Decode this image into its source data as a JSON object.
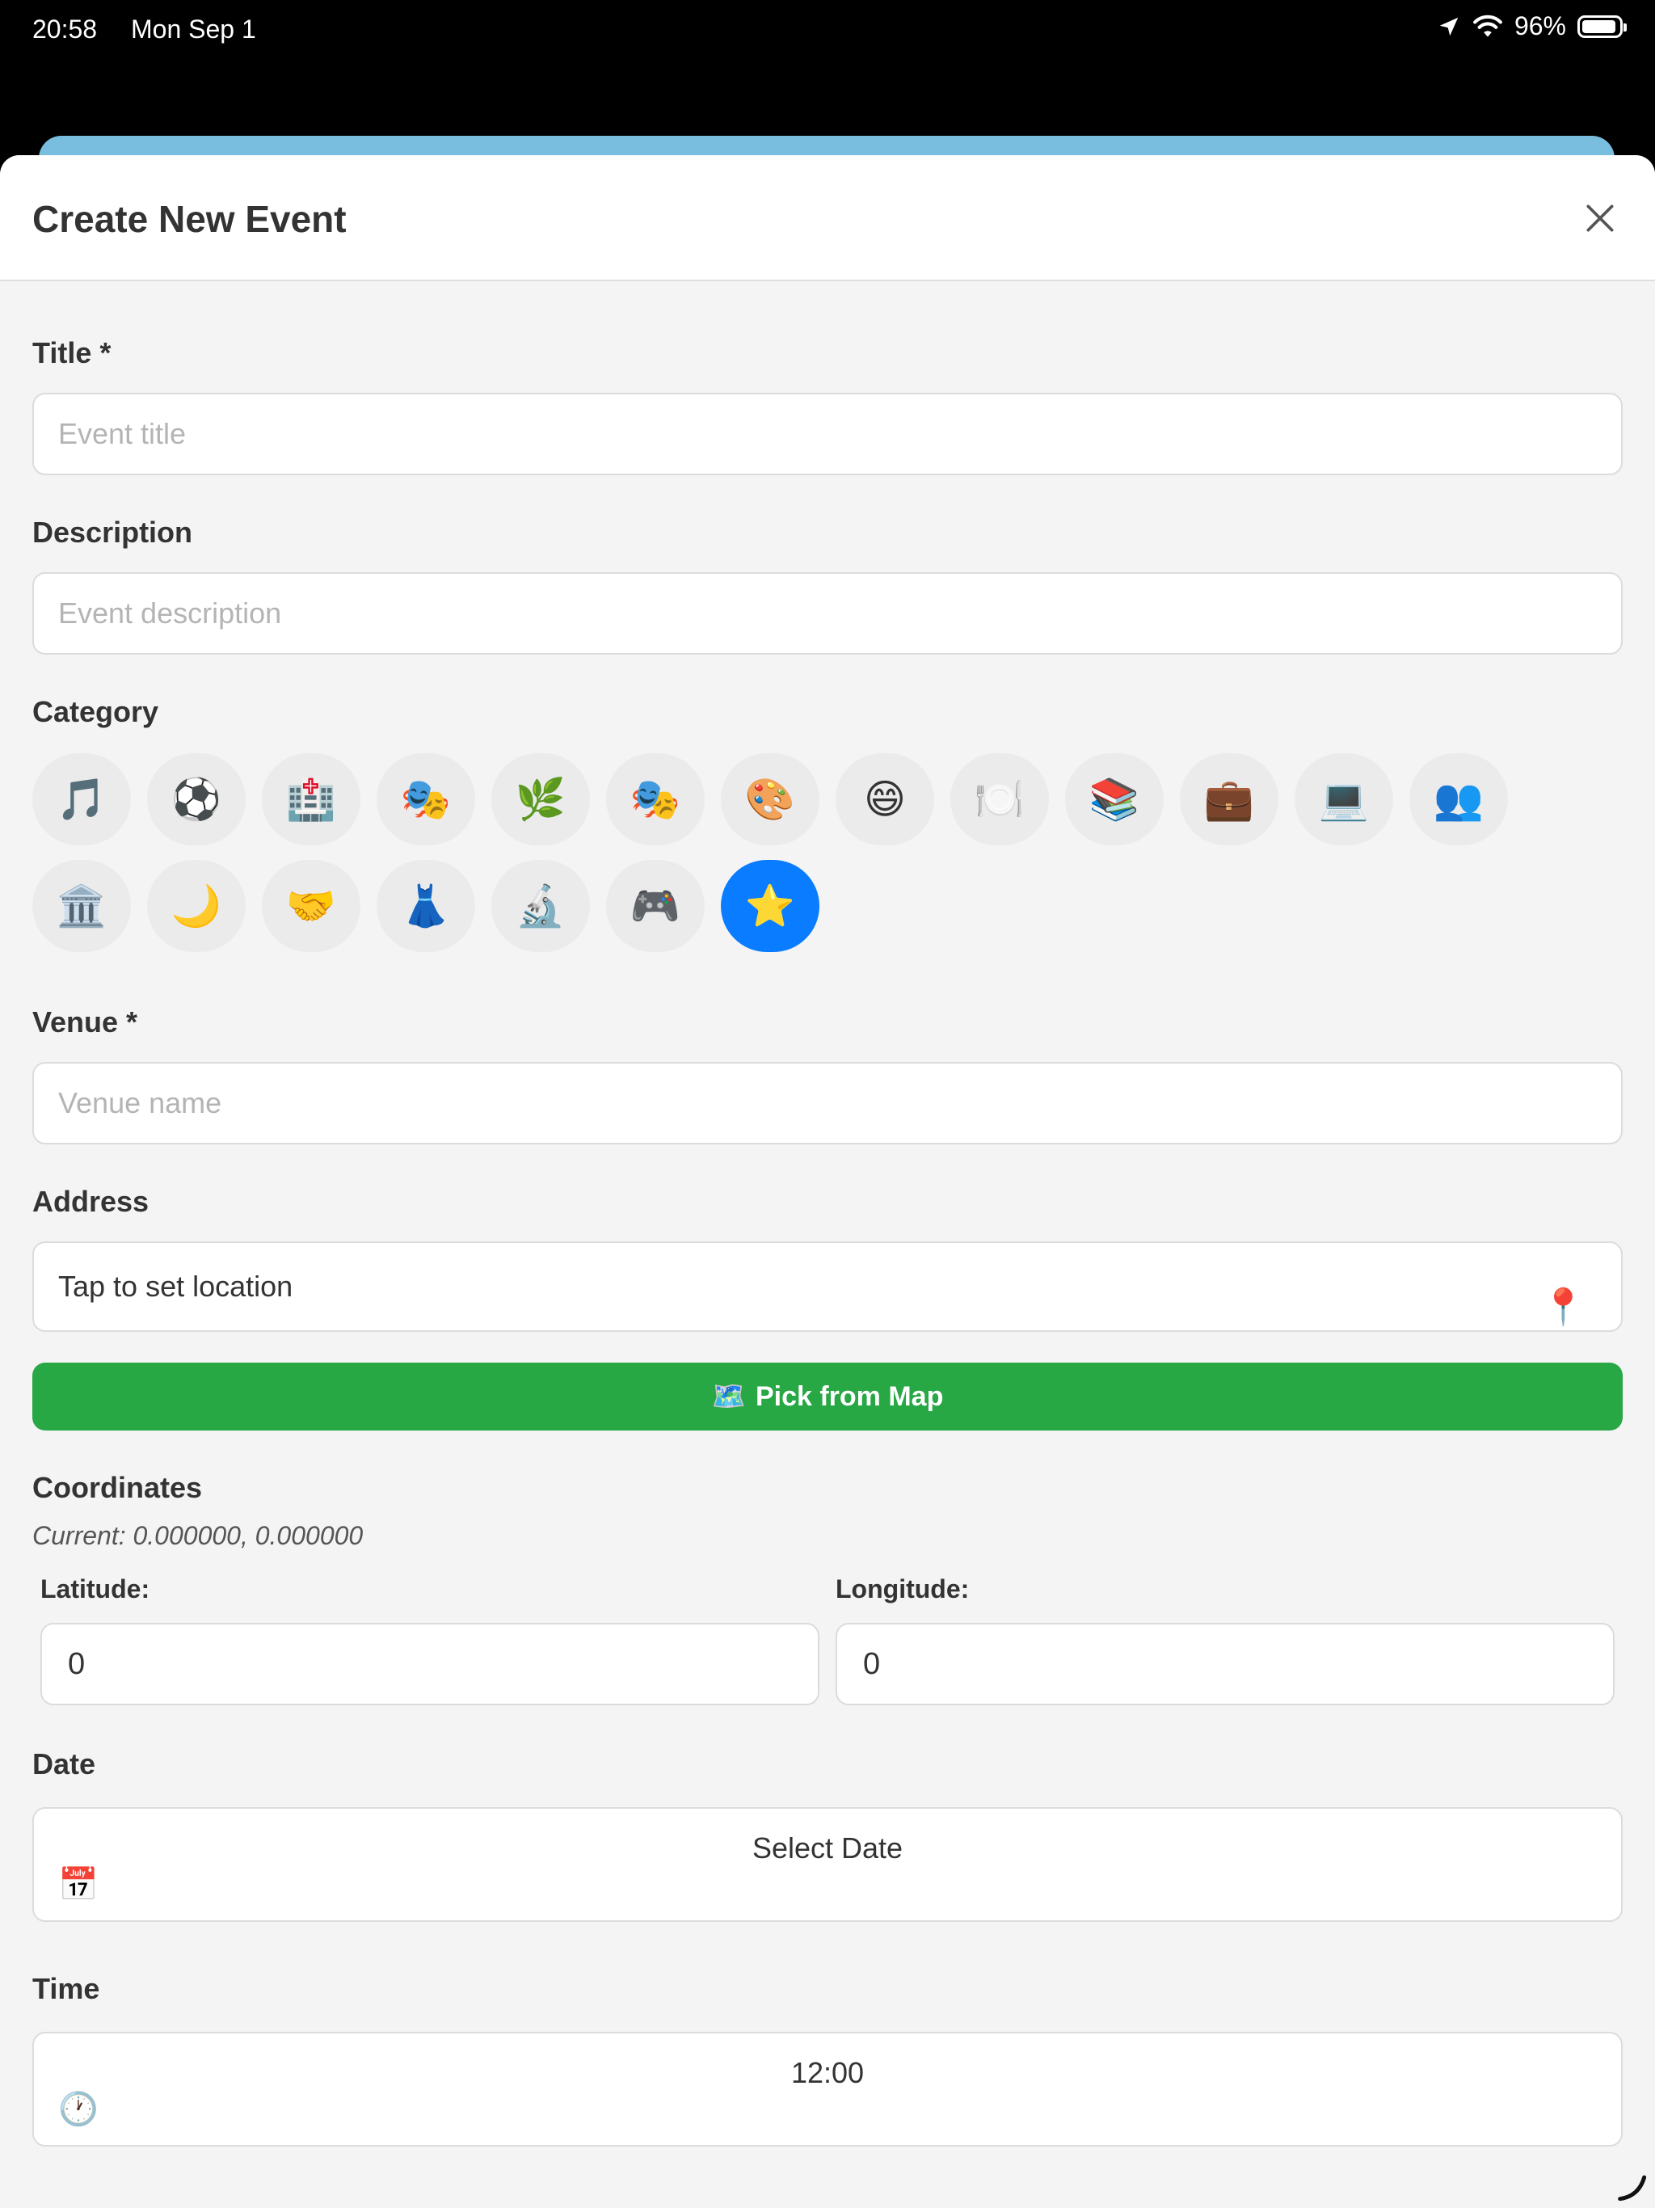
{
  "status_bar": {
    "time": "20:58",
    "date": "Mon Sep 1",
    "battery": "96%"
  },
  "header": {
    "title": "Create New Event"
  },
  "form": {
    "title_label": "Title *",
    "title_placeholder": "Event title",
    "description_label": "Description",
    "description_placeholder": "Event description",
    "category_label": "Category",
    "categories_row1": [
      "🎵",
      "⚽",
      "🏥",
      "🎭",
      "🌿",
      "🎭",
      "🎨",
      "😄",
      "🍽️",
      "📚",
      "💼",
      "💻",
      "👥"
    ],
    "categories_row2": [
      "🏛️",
      "🌙",
      "🤝",
      "👗",
      "🔬",
      "🎮",
      "⭐"
    ],
    "selected_category": "⭐",
    "venue_label": "Venue *",
    "venue_placeholder": "Venue name",
    "address_label": "Address",
    "address_value": "Tap to set location",
    "address_icon": "📍",
    "pick_map_icon": "🗺️",
    "pick_map_label": "Pick from Map",
    "coordinates_label": "Coordinates",
    "coordinates_current": "Current: 0.000000, 0.000000",
    "latitude_label": "Latitude:",
    "latitude_value": "0",
    "longitude_label": "Longitude:",
    "longitude_value": "0",
    "date_label": "Date",
    "date_value": "Select Date",
    "date_icon": "📅",
    "time_label": "Time",
    "time_value": "12:00",
    "time_icon": "🕐"
  },
  "colors": {
    "accent_blue": "#0a7cff",
    "button_green": "#28a745"
  }
}
